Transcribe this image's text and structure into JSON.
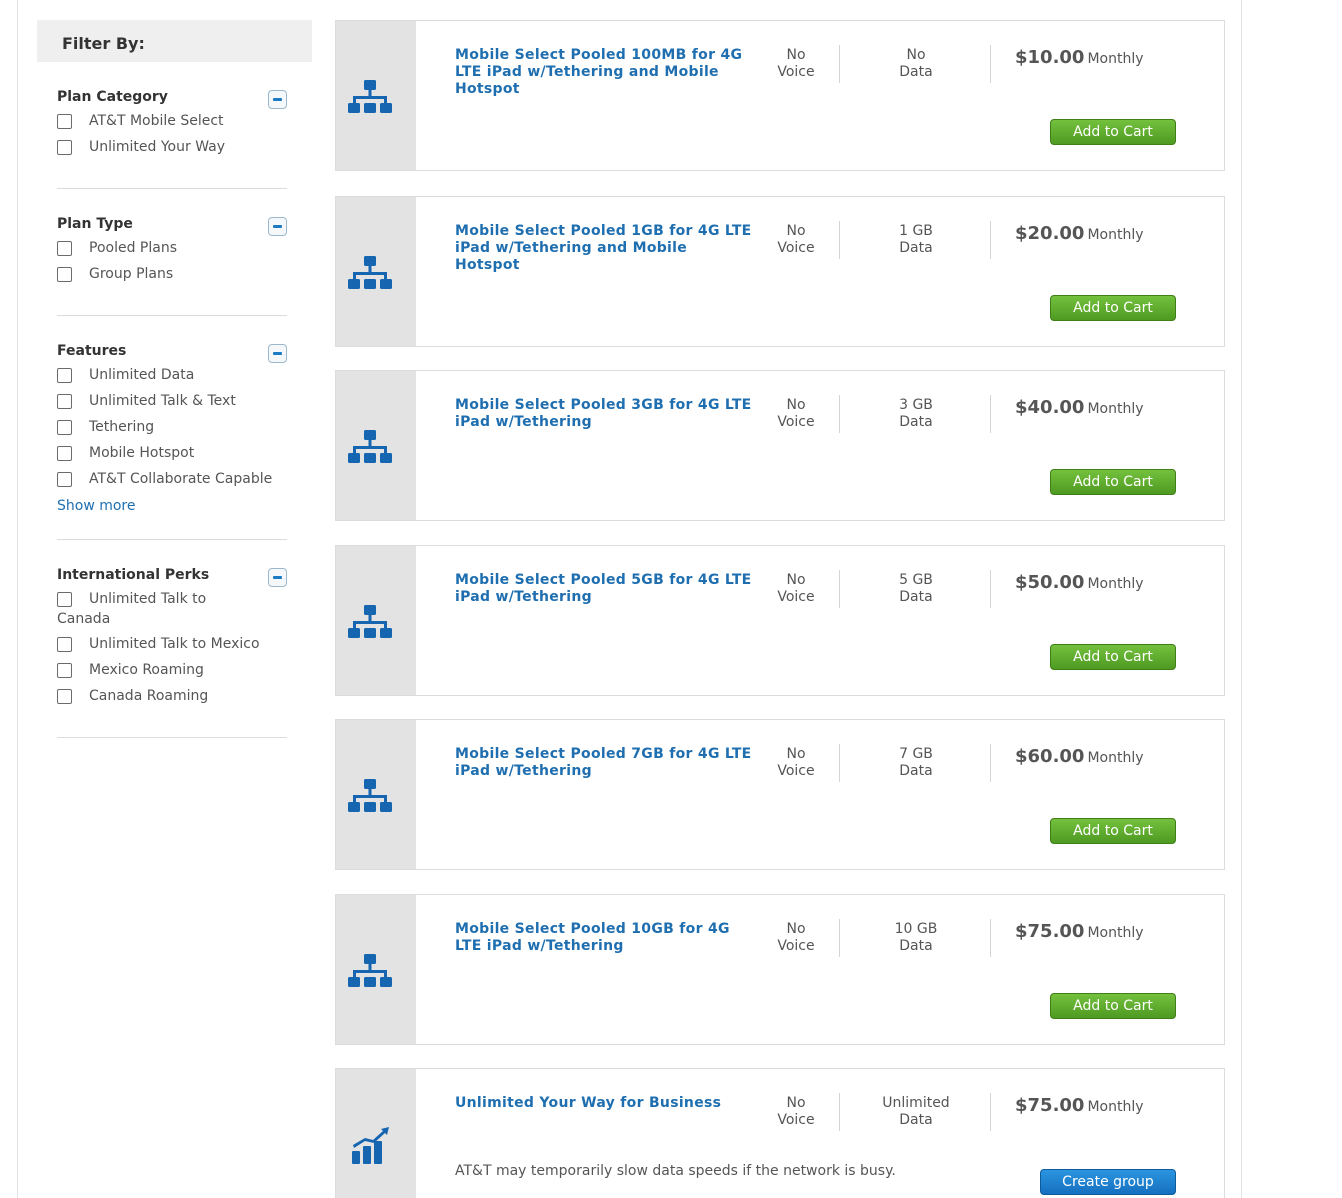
{
  "sidebar": {
    "header": "Filter By:",
    "groups": [
      {
        "title": "Plan Category",
        "options": [
          "AT&T Mobile Select",
          "Unlimited Your Way"
        ]
      },
      {
        "title": "Plan Type",
        "options": [
          "Pooled Plans",
          "Group Plans"
        ]
      },
      {
        "title": "Features",
        "options": [
          "Unlimited Data",
          "Unlimited Talk & Text",
          "Tethering",
          "Mobile Hotspot",
          "AT&T Collaborate Capable"
        ],
        "show_more": "Show more"
      },
      {
        "title": "International Perks",
        "options": [
          "Unlimited Talk to Canada",
          "Unlimited Talk to Mexico",
          "Mexico Roaming",
          "Canada Roaming"
        ]
      }
    ]
  },
  "plans": [
    {
      "name": "Mobile Select Pooled 100MB for 4G LTE iPad w/Tethering and Mobile Hotspot",
      "voice_1": "No",
      "voice_2": "Voice",
      "data_1": "No",
      "data_2": "Data",
      "price": "$10.00",
      "period": "Monthly",
      "button": "Add to Cart",
      "icon": "network-hierarchy-icon"
    },
    {
      "name": "Mobile Select Pooled 1GB for 4G LTE iPad w/Tethering and Mobile Hotspot",
      "voice_1": "No",
      "voice_2": "Voice",
      "data_1": "1 GB",
      "data_2": "Data",
      "price": "$20.00",
      "period": "Monthly",
      "button": "Add to Cart",
      "icon": "network-hierarchy-icon"
    },
    {
      "name": "Mobile Select Pooled 3GB for 4G LTE iPad w/Tethering",
      "voice_1": "No",
      "voice_2": "Voice",
      "data_1": "3 GB",
      "data_2": "Data",
      "price": "$40.00",
      "period": "Monthly",
      "button": "Add to Cart",
      "icon": "network-hierarchy-icon"
    },
    {
      "name": "Mobile Select Pooled 5GB for 4G LTE iPad w/Tethering",
      "voice_1": "No",
      "voice_2": "Voice",
      "data_1": "5 GB",
      "data_2": "Data",
      "price": "$50.00",
      "period": "Monthly",
      "button": "Add to Cart",
      "icon": "network-hierarchy-icon"
    },
    {
      "name": "Mobile Select Pooled 7GB for 4G LTE iPad w/Tethering",
      "voice_1": "No",
      "voice_2": "Voice",
      "data_1": "7 GB",
      "data_2": "Data",
      "price": "$60.00",
      "period": "Monthly",
      "button": "Add to Cart",
      "icon": "network-hierarchy-icon"
    },
    {
      "name": "Mobile Select Pooled 10GB for 4G LTE iPad w/Tethering",
      "voice_1": "No",
      "voice_2": "Voice",
      "data_1": "10 GB",
      "data_2": "Data",
      "price": "$75.00",
      "period": "Monthly",
      "button": "Add to Cart",
      "icon": "network-hierarchy-icon"
    },
    {
      "name": "Unlimited Your Way for Business",
      "voice_1": "No",
      "voice_2": "Voice",
      "data_1": "Unlimited",
      "data_2": "Data",
      "price": "$75.00",
      "period": "Monthly",
      "button": "Create group",
      "note": "AT&T may temporarily slow data speeds if the network is busy.",
      "icon": "bar-chart-growth-icon"
    }
  ],
  "colors": {
    "link_blue": "#1f6fb0",
    "add_green": "#5aa82a",
    "create_blue": "#1a7bc4",
    "icon_blue": "#1565b0"
  }
}
